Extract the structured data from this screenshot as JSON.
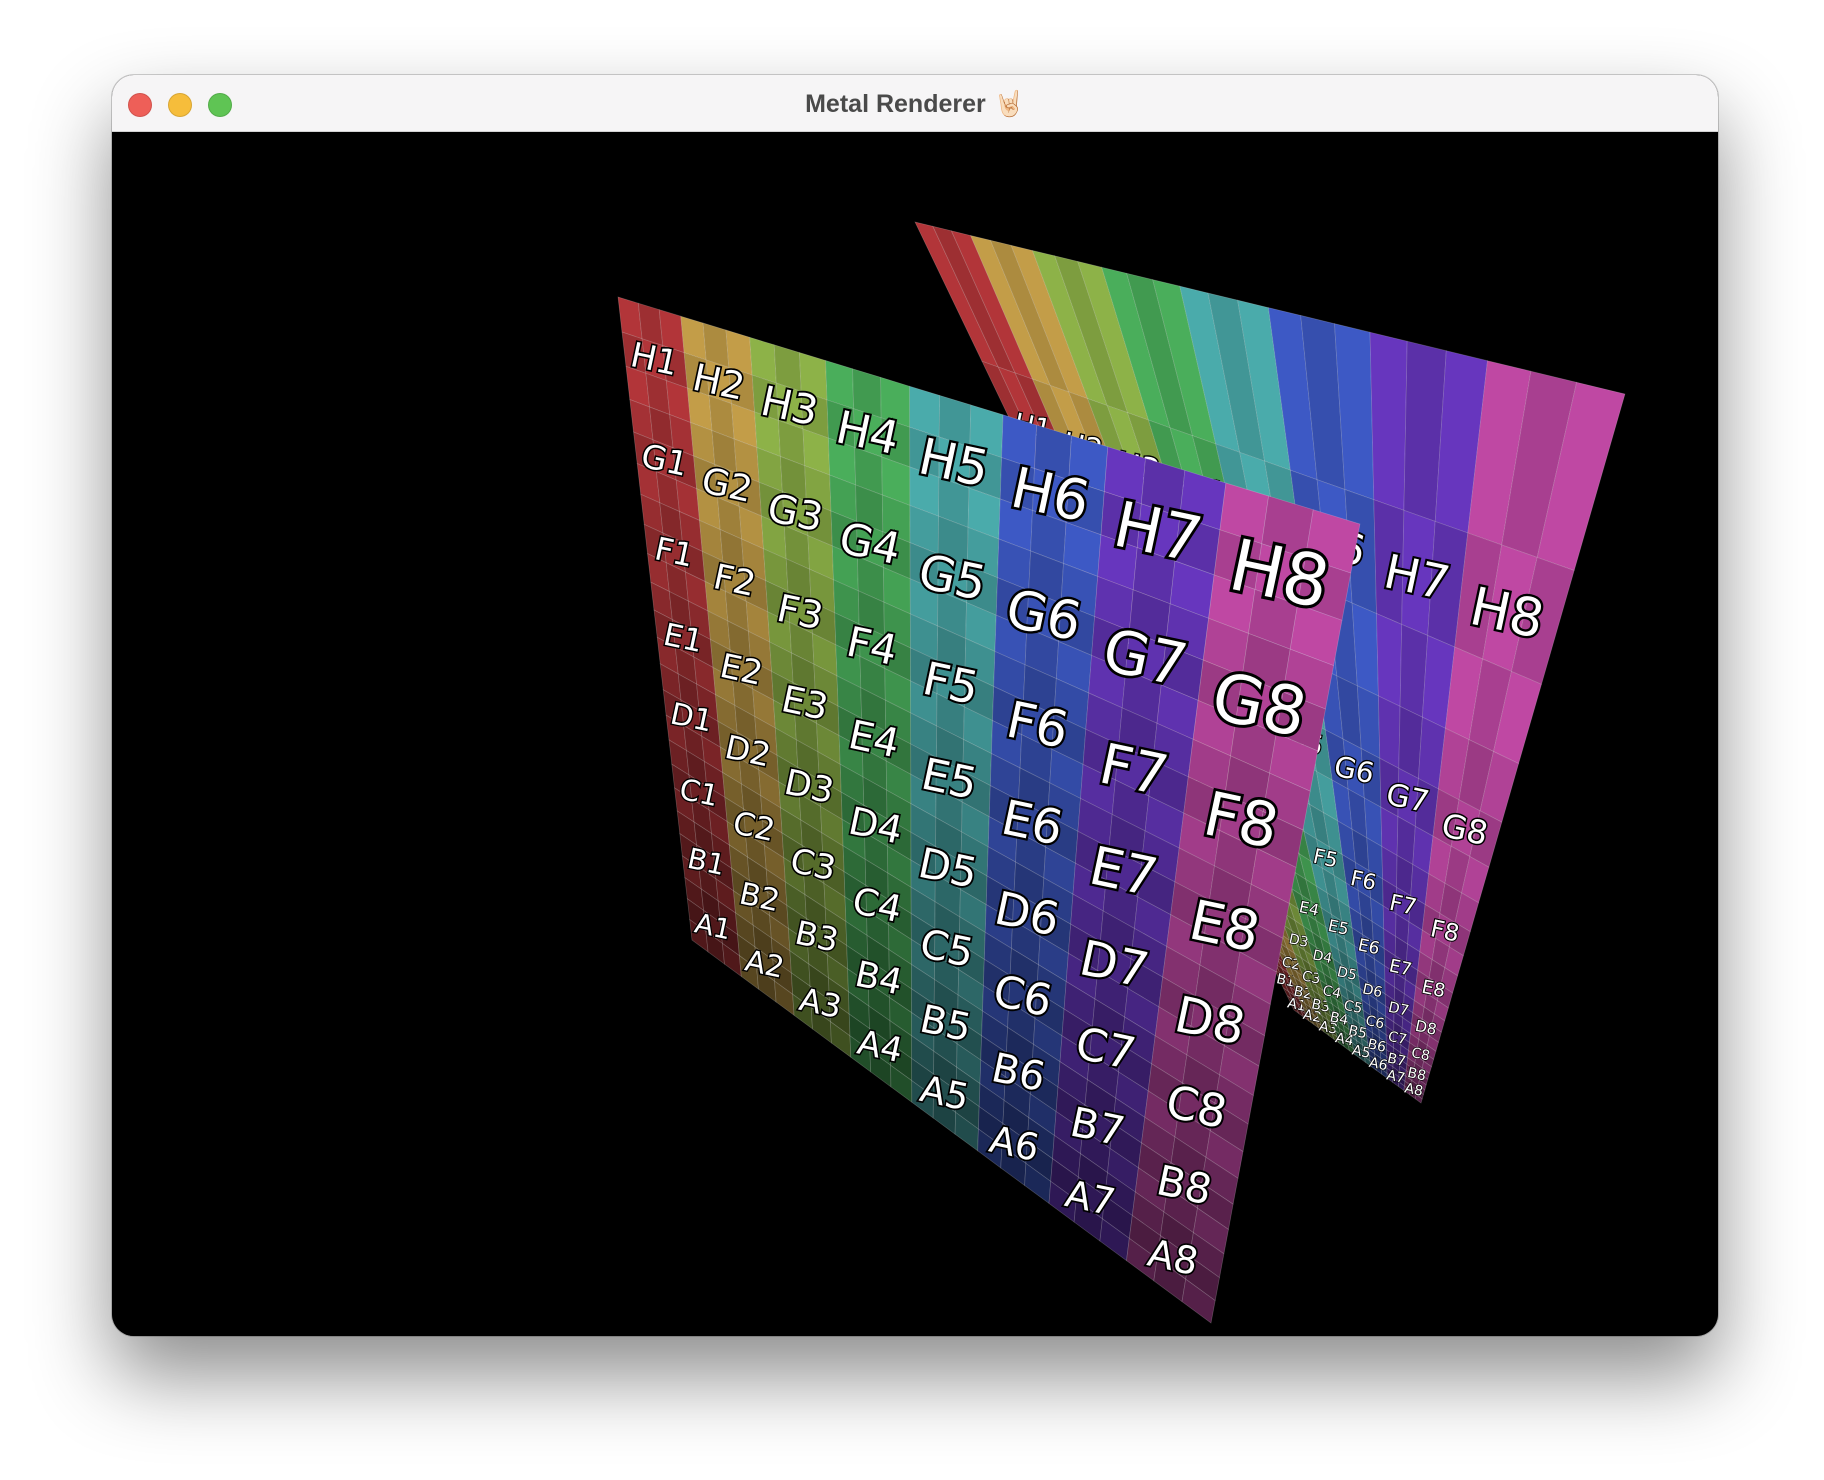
{
  "window": {
    "title": "Metal Renderer",
    "title_emoji": "🤘🏻",
    "controls": {
      "close_color": "#ee5f58",
      "minimize_color": "#f6bd3b",
      "maximize_color": "#5fc454"
    }
  },
  "scene": {
    "background": "#000000",
    "rows": [
      "H",
      "G",
      "F",
      "E",
      "D",
      "C",
      "B",
      "A"
    ],
    "columns": [
      "1",
      "2",
      "3",
      "4",
      "5",
      "6",
      "7",
      "8"
    ],
    "column_colors": [
      "#b8373b",
      "#c9a24a",
      "#92b84a",
      "#4cb45e",
      "#4cb0b0",
      "#3f5ccb",
      "#6a38c4",
      "#c54aa8"
    ],
    "planes": [
      {
        "name": "back-plane"
      },
      {
        "name": "front-plane"
      }
    ]
  }
}
